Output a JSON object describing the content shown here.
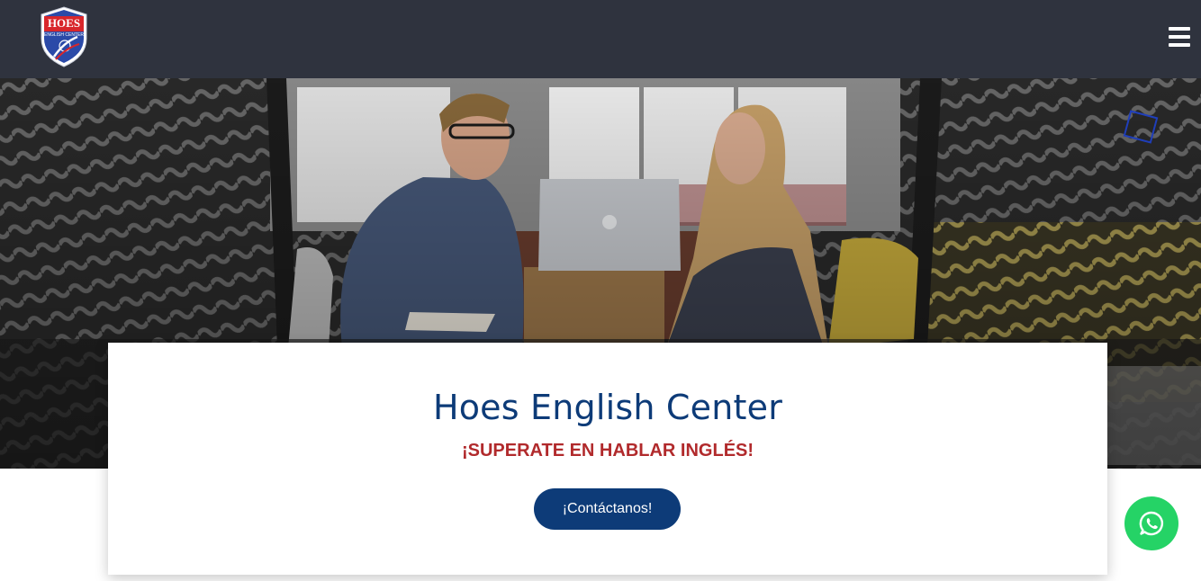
{
  "header": {
    "logo_text": "HOES",
    "logo_subtext": "ENGLISH CENTER",
    "menu_icon": "hamburger-menu-icon"
  },
  "hero": {
    "image": "two-people-working-at-laptop-photo",
    "title": "Hoes English Center",
    "subtitle": "¡SUPERATE EN HABLAR INGLÉS!",
    "cta_label": "¡Contáctanos!"
  },
  "floating": {
    "whatsapp_icon": "whatsapp-icon"
  },
  "colors": {
    "nav_bg": "#2f333e",
    "brand_blue": "#0d3b78",
    "accent_red": "#b12a2c",
    "whatsapp_green": "#25d366"
  }
}
